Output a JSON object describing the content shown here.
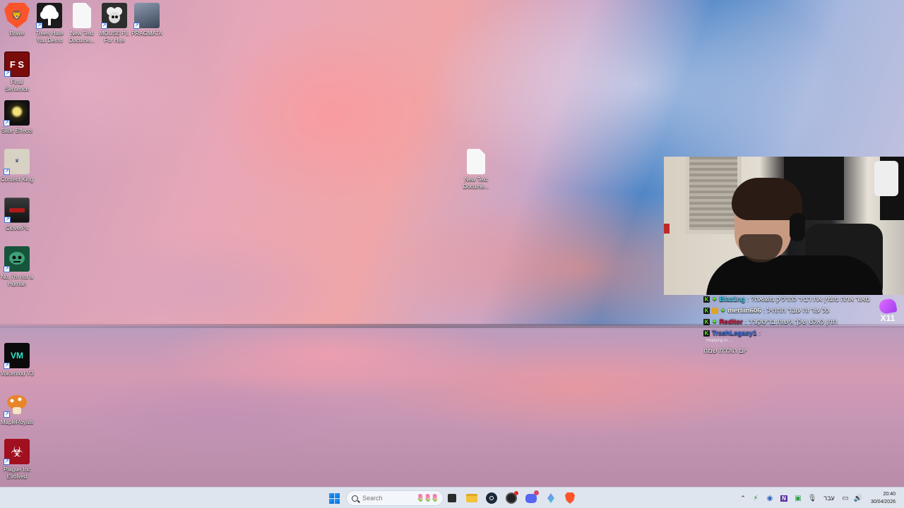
{
  "desktop": {
    "icons": [
      {
        "label": "Brave",
        "icon": "brave-lion-icon",
        "color": "#fb542b"
      },
      {
        "label": "Trees Hate\nYou Demo",
        "icon": "tree-icon",
        "color": "#ffffff"
      },
      {
        "label": "New Text\nDocume...",
        "icon": "text-file-icon",
        "color": "#ffffff"
      },
      {
        "label": "MOUSE P.I.\nFor Hire",
        "icon": "mouse-pi-icon",
        "color": "#444444"
      },
      {
        "label": "PRAGMATA",
        "icon": "pragmata-icon",
        "color": "#7a8aa0"
      },
      {
        "label": "Final\nSentence",
        "icon": "final-sentence-icon",
        "color": "#8a1010",
        "text": "F S"
      },
      {
        "label": "Slide Effects",
        "icon": "slide-effects-icon",
        "color": "#111111"
      },
      {
        "label": "Content King",
        "icon": "content-king-icon",
        "color": "#e9e2d0"
      },
      {
        "label": "CloverPit",
        "icon": "cloverpit-icon",
        "color": "#2a2a2a"
      },
      {
        "label": "No, I'm not a\nHuman",
        "icon": "not-human-icon",
        "color": "#1e6b4a"
      },
      {
        "label": "Voicemod V3",
        "icon": "voicemod-icon",
        "color": "#0f0f0f"
      },
      {
        "label": "MapleRoyals",
        "icon": "mapleroyals-icon",
        "color": "#e08a2a"
      },
      {
        "label": "Plague Inc\nEvolved",
        "icon": "plague-inc-icon",
        "color": "#b01e2a"
      },
      {
        "label": "New Text\nDocume...",
        "icon": "text-file-icon",
        "color": "#ffffff"
      }
    ]
  },
  "chat": {
    "messages": [
      {
        "user": "Blaz1ng",
        "user_color": "#46d2f0",
        "text": ": ?מאור אתה מזמין את דביר להדליק משואה"
      },
      {
        "user": "merliin606",
        "user_color": "#ffffff",
        "text": ": כל עוד זה עובד תתחיל"
      },
      {
        "user": "Reditor",
        "user_color": "#d4163c",
        "text": ": תתן לאלט שלך גישות בדיסקורד"
      },
      {
        "user": "TrashLegacy1",
        "user_color": "#3d6fd8",
        "text": ":"
      }
    ],
    "reply_hint": "Replying to ...",
    "last_message": "יום הולדת שמח",
    "logo_text": "X11"
  },
  "taskbar": {
    "search_placeholder": "Search",
    "language": "עבר",
    "time": "20:40",
    "date": "30/04/2026",
    "apps": [
      "file-explorer-icon",
      "task-view-icon",
      "folder-icon",
      "steam-icon",
      "obs-icon",
      "discord-icon",
      "app-icon",
      "brave-icon"
    ],
    "tray": [
      "chevron-up-icon",
      "network-icon",
      "app-tray-icon",
      "notion-icon",
      "app-tray-icon-2",
      "microphone-icon"
    ]
  }
}
